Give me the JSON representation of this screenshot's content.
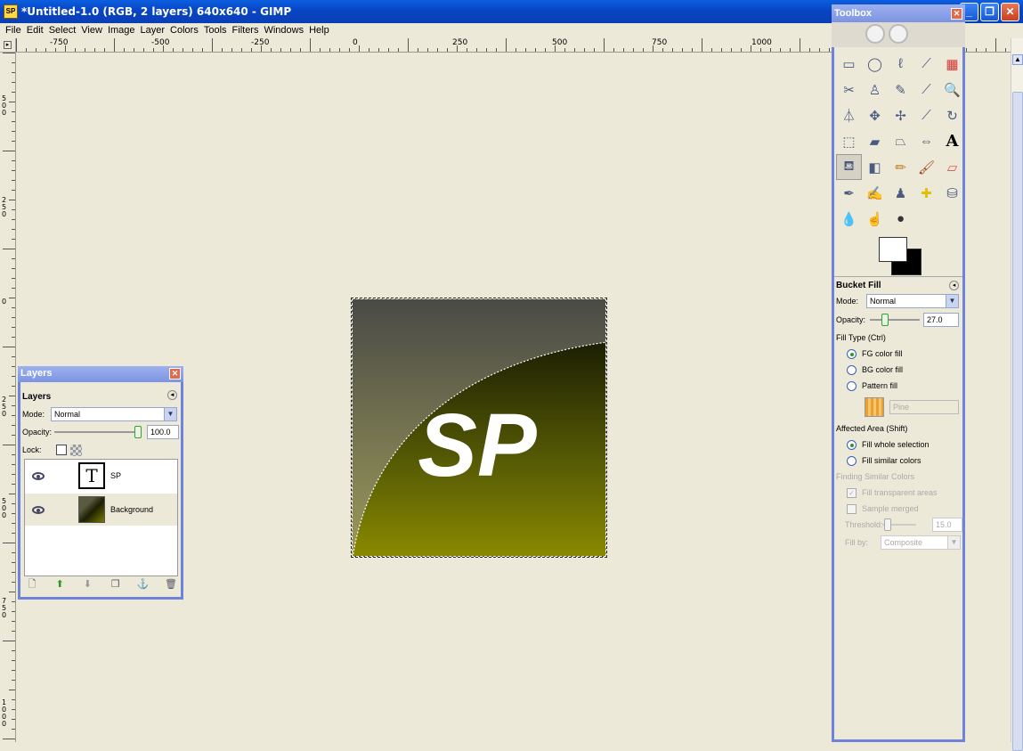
{
  "window": {
    "app_icon": "SP",
    "title": "*Untitled-1.0 (RGB, 2 layers) 640x640 - GIMP"
  },
  "menu": [
    "File",
    "Edit",
    "Select",
    "View",
    "Image",
    "Layer",
    "Colors",
    "Tools",
    "Filters",
    "Windows",
    "Help"
  ],
  "ruler": {
    "h_labels": [
      "-750",
      "-500",
      "-250",
      "0",
      "250",
      "500",
      "750",
      "1000"
    ],
    "v_labels": [
      "5\n0\n0",
      "2\n5\n0",
      "0",
      "2\n5\n0",
      "5\n0\n0",
      "7\n5\n0",
      "1\n0\n0\n0"
    ]
  },
  "image": {
    "text": "SP"
  },
  "layers": {
    "window_title": "Layers",
    "header": "Layers",
    "mode_label": "Mode:",
    "mode_value": "Normal",
    "opacity_label": "Opacity:",
    "opacity_value": "100.0",
    "opacity_level": 1.0,
    "lock_label": "Lock:",
    "items": [
      {
        "name": "SP",
        "type": "text"
      },
      {
        "name": "Background",
        "type": "image"
      }
    ],
    "buttons": [
      "new-layer-icon",
      "raise-layer-icon",
      "lower-layer-icon",
      "duplicate-layer-icon",
      "anchor-layer-icon",
      "delete-layer-icon"
    ]
  },
  "toolbox": {
    "title": "Toolbox",
    "fg_color": "#ffffff",
    "bg_color": "#000000",
    "tools": [
      "rect-select",
      "ellipse-select",
      "free-select",
      "fuzzy-select",
      "by-color-select",
      "scissors",
      "foreground-select",
      "paths",
      "color-picker",
      "zoom",
      "measure",
      "move",
      "align",
      "crop",
      "rotate",
      "scale",
      "shear",
      "perspective",
      "flip",
      "text",
      "bucket-fill",
      "blend",
      "pencil",
      "paintbrush",
      "eraser",
      "airbrush",
      "ink",
      "clone",
      "heal",
      "perspective-clone",
      "blur",
      "smudge",
      "dodge-burn"
    ],
    "options": {
      "title": "Bucket Fill",
      "mode_label": "Mode:",
      "mode_value": "Normal",
      "opacity_label": "Opacity:",
      "opacity_value": "27.0",
      "opacity_level": 0.27,
      "fill_type_label": "Fill Type  (Ctrl)",
      "fg_fill": "FG color fill",
      "bg_fill": "BG color fill",
      "pattern_fill": "Pattern fill",
      "pattern_name": "Pine",
      "affected_label": "Affected Area  (Shift)",
      "fill_whole": "Fill whole selection",
      "fill_similar": "Fill similar colors",
      "finding_label": "Finding Similar Colors",
      "fill_transparent": "Fill transparent areas",
      "sample_merged": "Sample merged",
      "threshold_label": "Threshold:",
      "threshold_value": "15.0",
      "threshold_level": 0.06,
      "fill_by_label": "Fill by:",
      "fill_by_value": "Composite"
    }
  },
  "colors": {
    "accent": "#6e83d9",
    "titlebar": "#0845c4",
    "image_dark": "#1c1f02",
    "image_olive": "#8a8a00"
  }
}
